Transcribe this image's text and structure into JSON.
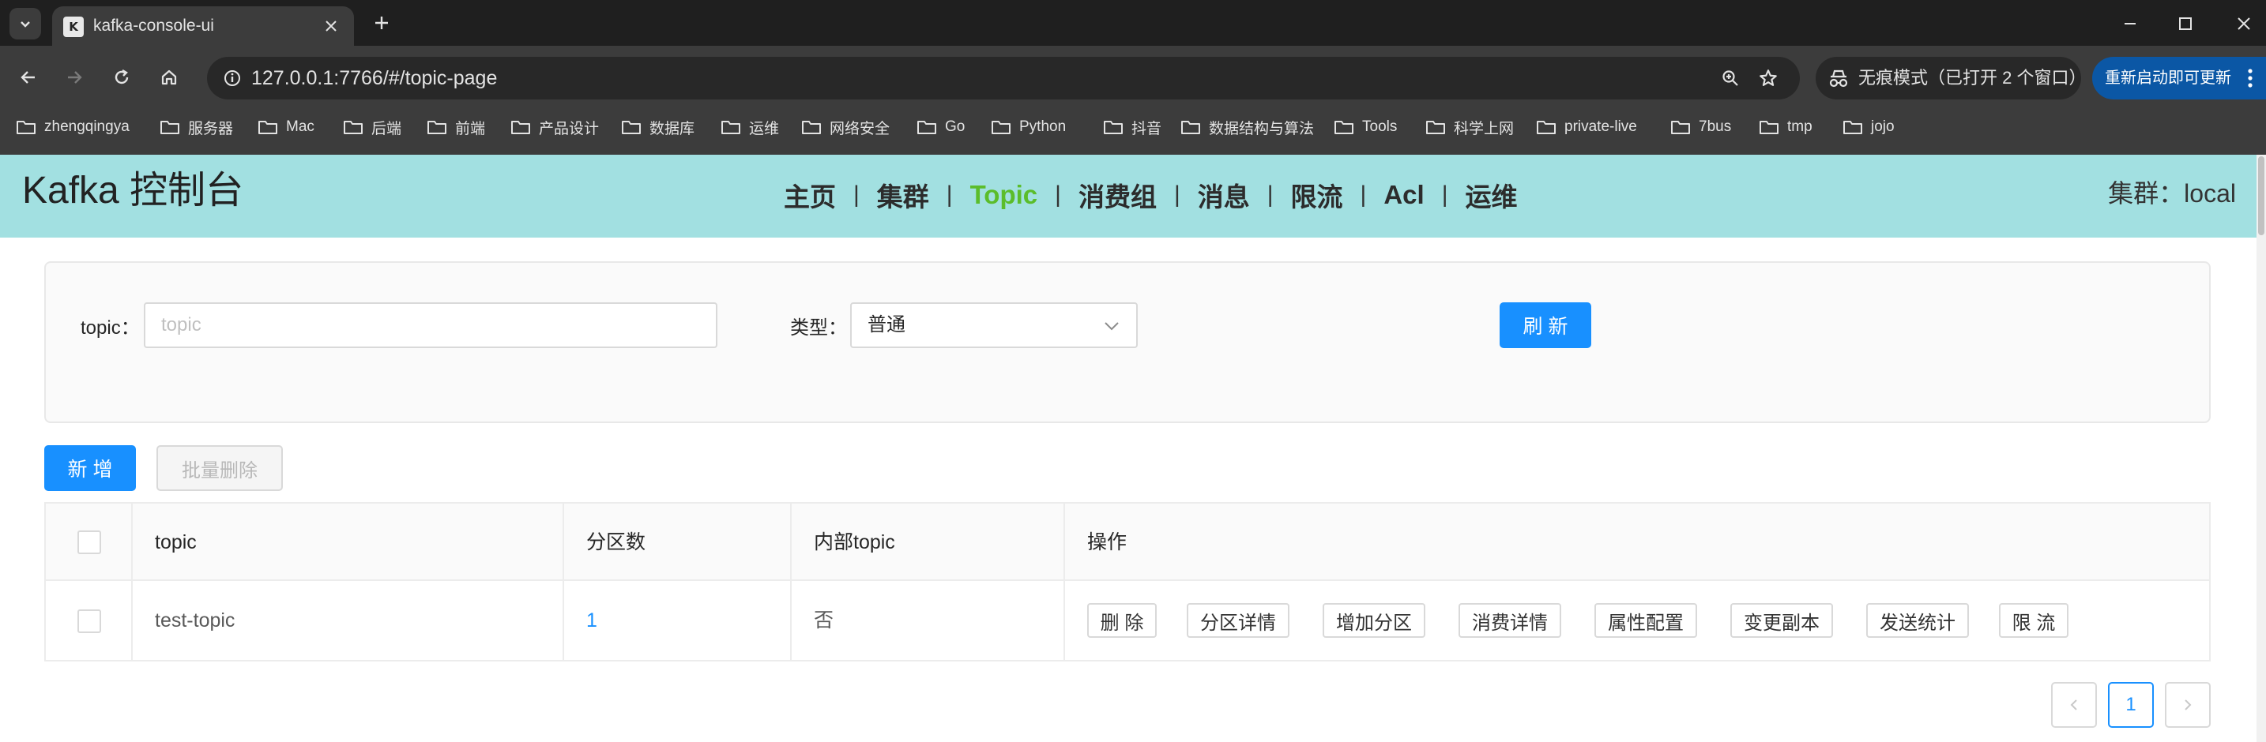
{
  "browser": {
    "tab_title": "kafka-console-ui",
    "url": "127.0.0.1:7766/#/topic-page",
    "incognito_text": "无痕模式（已打开 2 个窗口）",
    "relaunch_text": "重新启动即可更新",
    "bookmarks": [
      "zhengqingya",
      "服务器",
      "Mac",
      "后端",
      "前端",
      "产品设计",
      "数据库",
      "运维",
      "网络安全",
      "Go",
      "Python",
      "抖音",
      "数据结构与算法",
      "Tools",
      "科学上网",
      "private-live",
      "7bus",
      "tmp",
      "jojo"
    ]
  },
  "header": {
    "title": "Kafka 控制台",
    "menu": [
      "主页",
      "集群",
      "Topic",
      "消费组",
      "消息",
      "限流",
      "Acl",
      "运维"
    ],
    "active_menu": "Topic",
    "cluster_label": "集群：local"
  },
  "search": {
    "topic_label": "topic",
    "topic_placeholder": "topic",
    "type_label": "类型",
    "type_value": "普通",
    "refresh_label": "刷 新"
  },
  "actions": {
    "add_label": "新 增",
    "batch_delete_label": "批量删除"
  },
  "table": {
    "columns": [
      "topic",
      "分区数",
      "内部topic",
      "操作"
    ],
    "rows": [
      {
        "topic": "test-topic",
        "partitions": "1",
        "internal": "否"
      }
    ],
    "row_actions": [
      "删 除",
      "分区详情",
      "增加分区",
      "消费详情",
      "属性配置",
      "变更副本",
      "发送统计",
      "限 流"
    ]
  },
  "pagination": {
    "current_page": "1"
  },
  "colors": {
    "header_bg": "#a2e0e1",
    "active_menu": "#5bbd2b",
    "primary": "#1890ff",
    "link": "#1890ff"
  }
}
